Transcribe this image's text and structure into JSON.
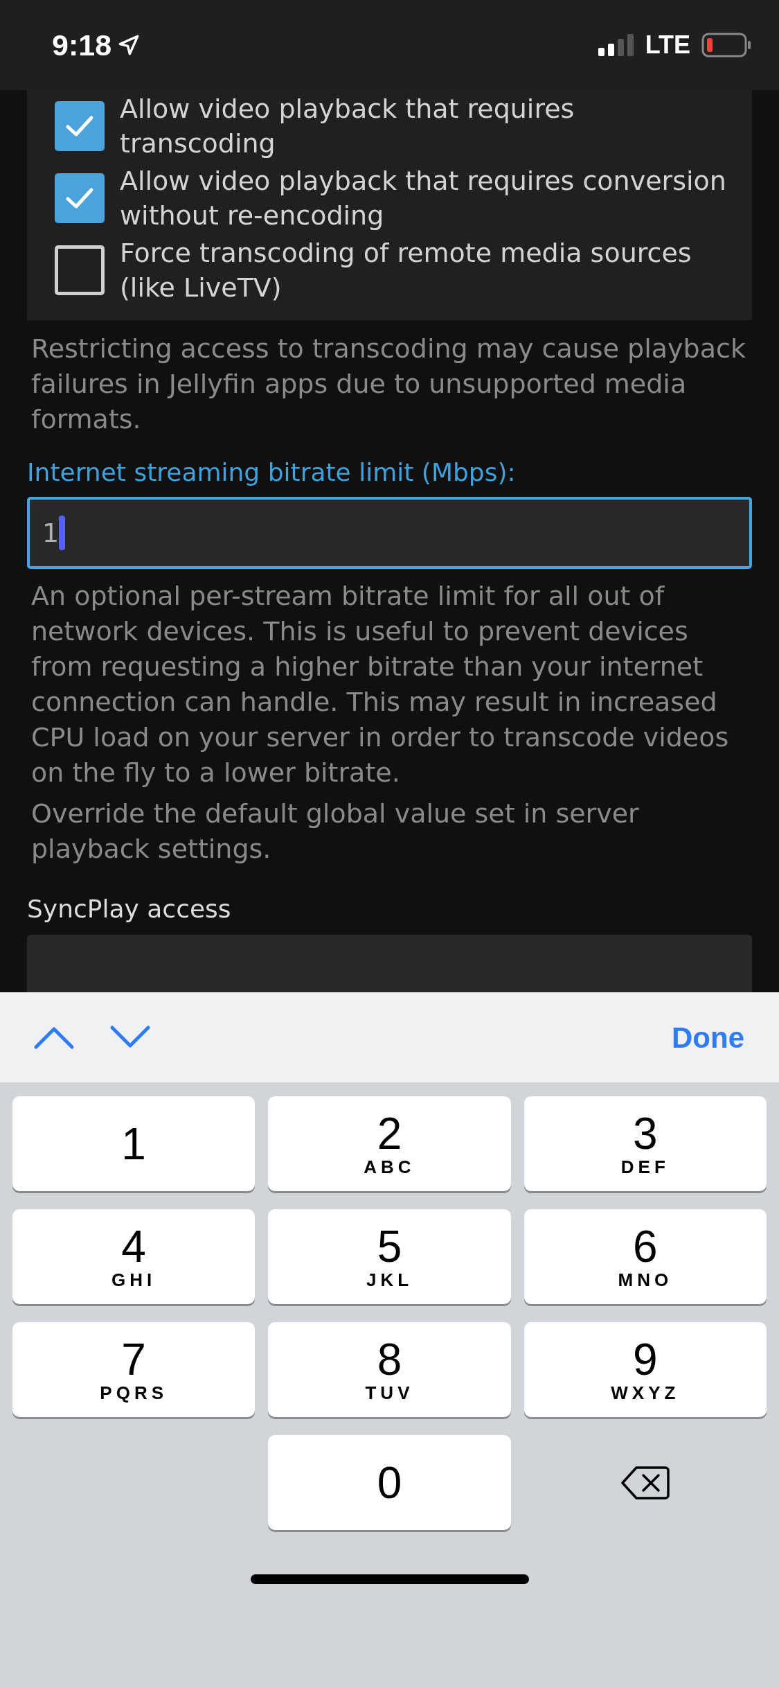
{
  "status_bar": {
    "time": "9:18",
    "network": "LTE"
  },
  "checkboxes": [
    {
      "label": "Allow video playback that requires transcoding",
      "checked": true
    },
    {
      "label": "Allow video playback that requires conversion without re-encoding",
      "checked": true
    },
    {
      "label": "Force transcoding of remote media sources (like LiveTV)",
      "checked": false
    }
  ],
  "transcoding_help": "Restricting access to transcoding may cause playback failures in Jellyfin apps due to unsupported media formats.",
  "bitrate_field": {
    "label": "Internet streaming bitrate limit (Mbps):",
    "value": "1",
    "focused": true,
    "help": [
      "An optional per-stream bitrate limit for all out of network devices. This is useful to prevent devices from requesting a higher bitrate than your internet connection can handle. This may result in increased CPU load on your server in order to transcode videos on the fly to a lower bitrate.",
      "Override the default global value set in server playback settings."
    ]
  },
  "syncplay": {
    "label": "SyncPlay access"
  },
  "keyboard": {
    "done": "Done",
    "keys": [
      {
        "kind": "digit",
        "digit": "1"
      },
      {
        "kind": "digit",
        "digit": "2",
        "letters": "ABC"
      },
      {
        "kind": "digit",
        "digit": "3",
        "letters": "DEF"
      },
      {
        "kind": "digit",
        "digit": "4",
        "letters": "GHI"
      },
      {
        "kind": "digit",
        "digit": "5",
        "letters": "JKL"
      },
      {
        "kind": "digit",
        "digit": "6",
        "letters": "MNO"
      },
      {
        "kind": "digit",
        "digit": "7",
        "letters": "PQRS"
      },
      {
        "kind": "digit",
        "digit": "8",
        "letters": "TUV"
      },
      {
        "kind": "digit",
        "digit": "9",
        "letters": "WXYZ"
      },
      {
        "kind": "blank"
      },
      {
        "kind": "digit",
        "digit": "0"
      },
      {
        "kind": "delete"
      }
    ]
  }
}
